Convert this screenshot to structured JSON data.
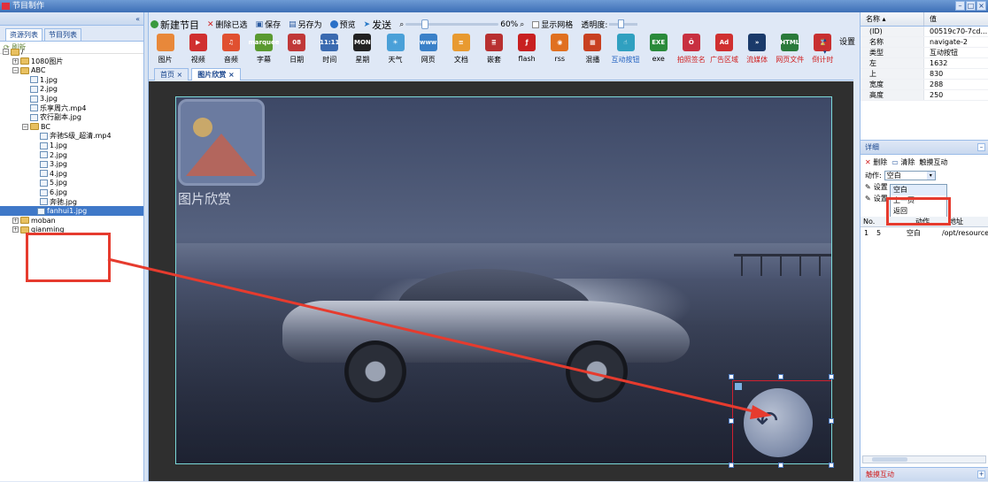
{
  "window": {
    "title": "节目制作"
  },
  "left_panel": {
    "collapse": "«",
    "tabs": [
      "资源列表",
      "节目列表"
    ],
    "refresh": "刷新",
    "tree": [
      {
        "label": "/",
        "kind": "folder",
        "depth": 0
      },
      {
        "label": "1080图片",
        "kind": "folder",
        "depth": 1
      },
      {
        "label": "ABC",
        "kind": "folder",
        "depth": 1
      },
      {
        "label": "1.jpg",
        "kind": "file",
        "depth": 2
      },
      {
        "label": "2.jpg",
        "kind": "file",
        "depth": 2
      },
      {
        "label": "3.jpg",
        "kind": "file",
        "depth": 2
      },
      {
        "label": "乐享周六.mp4",
        "kind": "file",
        "depth": 2
      },
      {
        "label": "农行副本.jpg",
        "kind": "file",
        "depth": 2
      },
      {
        "label": "BC",
        "kind": "folder",
        "depth": 2
      },
      {
        "label": "奔驰S级_超清.mp4",
        "kind": "file",
        "depth": 3
      },
      {
        "label": "1.jpg",
        "kind": "file",
        "depth": 3
      },
      {
        "label": "2.jpg",
        "kind": "file",
        "depth": 3
      },
      {
        "label": "3.jpg",
        "kind": "file",
        "depth": 3
      },
      {
        "label": "4.jpg",
        "kind": "file",
        "depth": 3
      },
      {
        "label": "5.jpg",
        "kind": "file",
        "depth": 3
      },
      {
        "label": "6.jpg",
        "kind": "file",
        "depth": 3
      },
      {
        "label": "奔驰.jpg",
        "kind": "file",
        "depth": 3
      },
      {
        "label": "fanhui1.jpg",
        "kind": "file",
        "depth": 3,
        "selected": true
      },
      {
        "label": "moban",
        "kind": "folder",
        "depth": 1
      },
      {
        "label": "qianming",
        "kind": "folder",
        "depth": 1
      }
    ]
  },
  "toolbar": {
    "new": "新建节目",
    "delete_sel": "删除已选",
    "save": "保存",
    "save_as": "另存为",
    "preview": "预览",
    "send": "发送",
    "zoom": "60%",
    "grid": "显示网格",
    "opacity": "透明度:"
  },
  "tools": [
    {
      "label": "图片",
      "color": "#e8883a",
      "glyph": ""
    },
    {
      "label": "视频",
      "color": "#d03030",
      "glyph": "▶"
    },
    {
      "label": "音频",
      "color": "#e05030",
      "glyph": "♫"
    },
    {
      "label": "字幕",
      "color": "#5a9a30",
      "glyph": "marquee"
    },
    {
      "label": "日期",
      "color": "#c03838",
      "glyph": "08"
    },
    {
      "label": "时间",
      "color": "#3a6ab0",
      "glyph": "11:11"
    },
    {
      "label": "星期",
      "color": "#222222",
      "glyph": "MON"
    },
    {
      "label": "天气",
      "color": "#4aa0d8",
      "glyph": "☀"
    },
    {
      "label": "网页",
      "color": "#3a80c8",
      "glyph": "www"
    },
    {
      "label": "文档",
      "color": "#e89a30",
      "glyph": "≡"
    },
    {
      "label": "嵌套",
      "color": "#b83030",
      "glyph": "≣"
    },
    {
      "label": "flash",
      "color": "#c82020",
      "glyph": "ƒ"
    },
    {
      "label": "rss",
      "color": "#e07020",
      "glyph": "◉"
    },
    {
      "label": "混播",
      "color": "#c84020",
      "glyph": "▦"
    },
    {
      "label": "互动按钮",
      "color": "#30a0c0",
      "glyph": "☝",
      "tone": "blue"
    },
    {
      "label": "exe",
      "color": "#2a8a3a",
      "glyph": "EXE"
    },
    {
      "label": "拍照签名",
      "color": "#c83040",
      "glyph": "Ŏ",
      "tone": "red"
    },
    {
      "label": "广告区域",
      "color": "#d03030",
      "glyph": "Ad",
      "tone": "red"
    },
    {
      "label": "流媒体",
      "color": "#1a3a6a",
      "glyph": "»",
      "tone": "red"
    },
    {
      "label": "网页文件",
      "color": "#2a7a3a",
      "glyph": "HTML",
      "tone": "red"
    },
    {
      "label": "倒计时",
      "color": "#c83030",
      "glyph": "⌛",
      "tone": "red"
    }
  ],
  "settings_label": "设置",
  "file_tabs": [
    "首页",
    "图片欣赏"
  ],
  "stage": {
    "caption": "图片欣赏",
    "placeholder_alt": "图片"
  },
  "properties": {
    "col_name": "名称 ▴",
    "col_value": "值",
    "rows": [
      {
        "k": "(ID)",
        "v": "00519c70-7cd..."
      },
      {
        "k": "名称",
        "v": "navigate-2"
      },
      {
        "k": "类型",
        "v": "互动按钮"
      },
      {
        "k": "左",
        "v": "1632"
      },
      {
        "k": "上",
        "v": "830"
      },
      {
        "k": "宽度",
        "v": "288"
      },
      {
        "k": "高度",
        "v": "250"
      }
    ]
  },
  "detail": {
    "title": "详细",
    "delete": "删除",
    "clear": "清除",
    "touch": "触摸互动",
    "action_label": "动作:",
    "action_value": "空白",
    "set1": "设置",
    "set2": "设置",
    "options": [
      "空白",
      "上一页",
      "返回"
    ],
    "grid_header": [
      "No.",
      "动作",
      "地址"
    ],
    "grid_row": [
      "1",
      "5",
      "空白",
      "/opt/resource"
    ],
    "footer": "触摸互动"
  }
}
